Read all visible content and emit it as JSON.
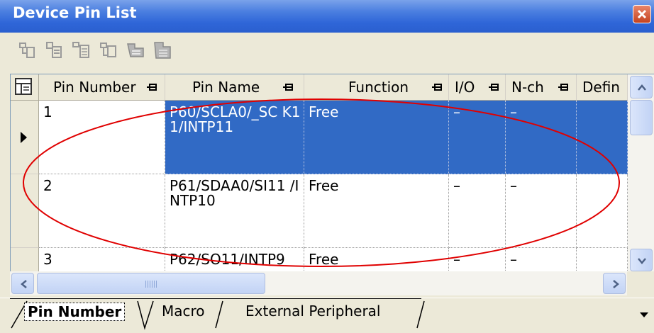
{
  "window": {
    "title": "Device Pin List"
  },
  "toolbar": {
    "icons": [
      "pin-list-icon-1",
      "pin-list-icon-2",
      "pin-list-icon-3",
      "pin-list-icon-4",
      "pin-list-icon-5",
      "pin-list-icon-6"
    ]
  },
  "table": {
    "columns": [
      "Pin Number",
      "Pin Name",
      "Function",
      "I/O",
      "N-ch",
      "Defin"
    ],
    "rows": [
      {
        "pin_number": "1",
        "pin_name": "P60/SCLA0/_SC K11/INTP11",
        "function": "Free",
        "io": "–",
        "nch": "–"
      },
      {
        "pin_number": "2",
        "pin_name": "P61/SDAA0/SI11 /INTP10",
        "function": "Free",
        "io": "–",
        "nch": "–"
      },
      {
        "pin_number": "3",
        "pin_name": "P62/SO11/INTP9",
        "function": "Free",
        "io": "–",
        "nch": "–"
      }
    ]
  },
  "tabs": [
    "Pin Number",
    "Macro",
    "External Peripheral"
  ],
  "colors": {
    "selection": "#316ac5",
    "titlebar": "#2f66d8",
    "annotation": "#e00000"
  }
}
